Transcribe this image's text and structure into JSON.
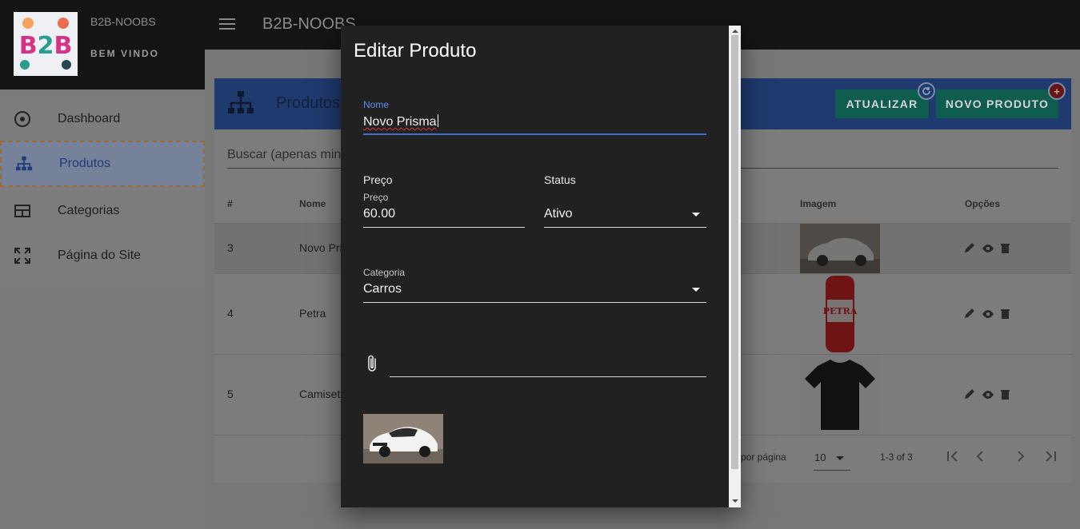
{
  "sidebar": {
    "brand": "B2B-NOOBS",
    "welcome": "BEM VINDO",
    "logo_text": "B2B",
    "items": [
      {
        "label": "Dashboard",
        "icon": "dashboard-icon"
      },
      {
        "label": "Produtos",
        "icon": "sitemap-icon",
        "active": true
      },
      {
        "label": "Categorias",
        "icon": "table-icon"
      },
      {
        "label": "Página do Site",
        "icon": "expand-icon"
      }
    ]
  },
  "appbar": {
    "title": "B2B-NOOBS"
  },
  "products": {
    "title": "Produtos",
    "refresh_button": "ATUALIZAR",
    "new_button": "NOVO PRODUTO",
    "badge_new": "+",
    "search_placeholder": "Buscar (apenas min",
    "columns": [
      "#",
      "Nome",
      "Imagem",
      "Opções"
    ],
    "rows": [
      {
        "id": "3",
        "name": "Novo Pri"
      },
      {
        "id": "4",
        "name": "Petra"
      },
      {
        "id": "5",
        "name": "Camiset"
      }
    ],
    "pagination": {
      "rows_per_page_label": "por página",
      "rows_per_page": "10",
      "range": "1-3 of 3"
    }
  },
  "dialog": {
    "title": "Editar Produto",
    "nome_label": "Nome",
    "nome_value": "Novo Prisma",
    "preco_section": "Preço",
    "preco_label": "Preço",
    "preco_value": "60.00",
    "status_section": "Status",
    "status_value": "Ativo",
    "categoria_label": "Categoria",
    "categoria_value": "Carros",
    "petra_can_text": "PETRA"
  },
  "colors": {
    "accent_blue": "#3f6fd0",
    "button_green": "#1b9e80",
    "badge_red": "#c62828",
    "dialog_bg": "#212121"
  }
}
